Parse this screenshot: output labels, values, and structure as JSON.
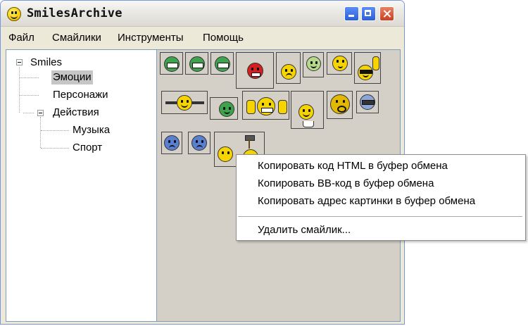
{
  "window": {
    "title": "SmilesArchive"
  },
  "menu": [
    "Файл",
    "Смайлики",
    "Инструменты",
    "Помощь"
  ],
  "tree": {
    "root": "Smiles",
    "items": [
      "Эмоции",
      "Персонажи",
      "Действия",
      "Музыка",
      "Спорт"
    ],
    "selected": "Эмоции"
  },
  "context_menu": {
    "items": [
      "Копировать код HTML в буфер обмена",
      "Копировать BB-код в буфер обмена",
      "Копировать адрес картинки в буфер обмена",
      "Удалить смайлик..."
    ]
  },
  "colors": {
    "smiley_yellow": "#f5d400",
    "smiley_green": "#3fa34d",
    "smiley_red": "#d42020",
    "smiley_blue": "#5a7fd0",
    "selection": "#c6c6c6",
    "title_accent": "#2b5fd9"
  },
  "icons": [
    "smiley-app-icon",
    "minimize-icon",
    "maximize-icon",
    "close-icon",
    "tree-collapse-icon"
  ]
}
